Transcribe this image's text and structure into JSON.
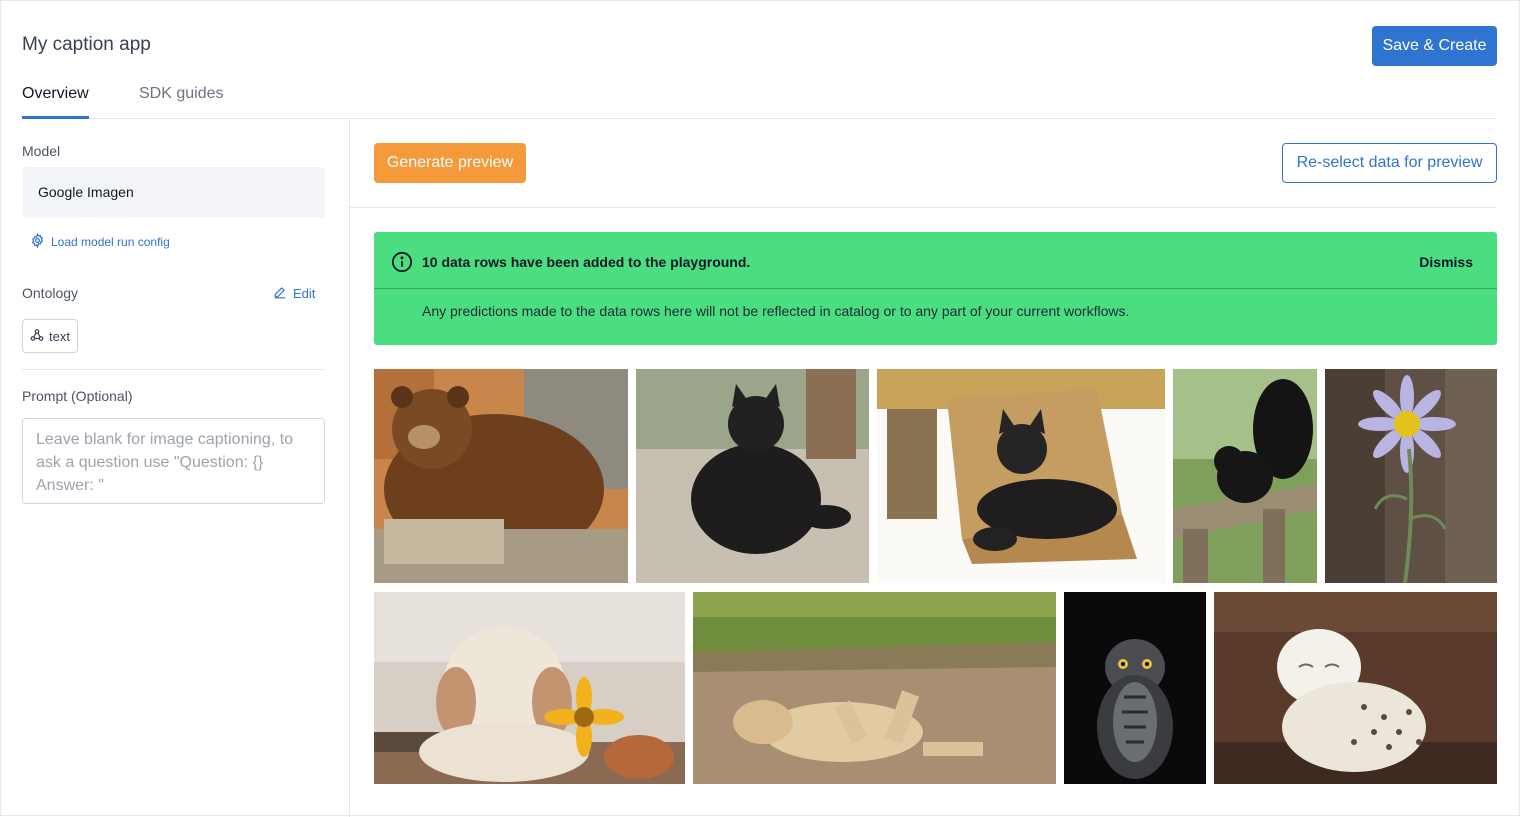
{
  "header": {
    "title": "My caption app",
    "save_label": "Save & Create"
  },
  "tabs": [
    {
      "label": "Overview",
      "active": true
    },
    {
      "label": "SDK guides",
      "active": false
    }
  ],
  "sidebar": {
    "model_label": "Model",
    "model_value": "Google Imagen",
    "load_config_label": "Load model run config",
    "ontology_label": "Ontology",
    "edit_label": "Edit",
    "ontology_chip": "text",
    "prompt_label": "Prompt (Optional)",
    "prompt_placeholder": "Leave blank for image captioning, to ask a question use \"Question: {} Answer: \""
  },
  "toolbar": {
    "generate_label": "Generate preview",
    "reselect_label": "Re-select data for preview"
  },
  "banner": {
    "title": "10 data rows have been added to the playground.",
    "dismiss_label": "Dismiss",
    "message": "Any predictions made to the data rows here will not be reflected in catalog or to any part of your current workflows.",
    "color": "#4ade80"
  },
  "thumbnails": [
    {
      "subject": "brown bear"
    },
    {
      "subject": "black kitten"
    },
    {
      "subject": "black cat in cardboard box"
    },
    {
      "subject": "black squirrel"
    },
    {
      "subject": "purple aster flower"
    },
    {
      "subject": "puppy with yellow flower"
    },
    {
      "subject": "lion lying on dirt"
    },
    {
      "subject": "great grey owl"
    },
    {
      "subject": "snowy owl"
    }
  ],
  "colors": {
    "primary": "#2f74d0",
    "orange": "#f59a3b",
    "success": "#4ade80"
  }
}
